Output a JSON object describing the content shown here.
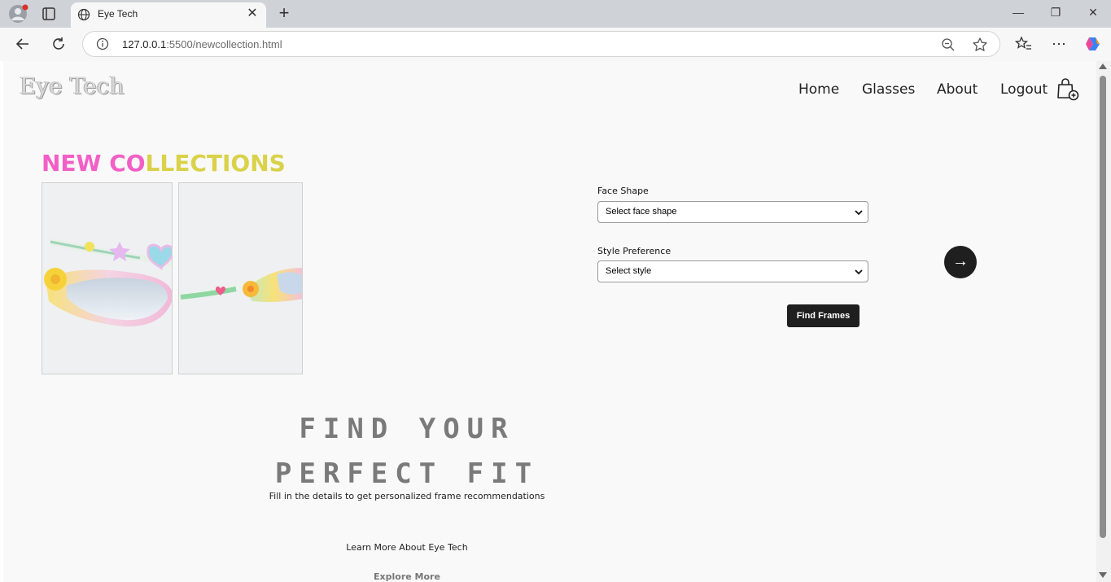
{
  "browser": {
    "tab_title": "Eye Tech",
    "url_host": "127.0.0.1",
    "url_path": ":5500/newcollection.html"
  },
  "header": {
    "logo": "Eye Tech",
    "nav": [
      "Home",
      "Glasses",
      "About",
      "Logout"
    ]
  },
  "collection": {
    "title_part1": "NEW CO",
    "title_part2": "LLECTIONS",
    "accent_pink": "#f25fc6",
    "accent_yellow": "#d9d24a"
  },
  "hero": {
    "title_line1": "FIND YOUR",
    "title_line2": "PERFECT FIT",
    "subtitle": "Fill in the details to get personalized frame recommendations",
    "learn_more": "Learn More About Eye Tech",
    "explore_more": "Explore More"
  },
  "form": {
    "face_label": "Face Shape",
    "face_value": "Select face shape",
    "style_label": "Style Preference",
    "style_value": "Select style",
    "submit_label": "Find Frames",
    "next_arrow": "→"
  }
}
